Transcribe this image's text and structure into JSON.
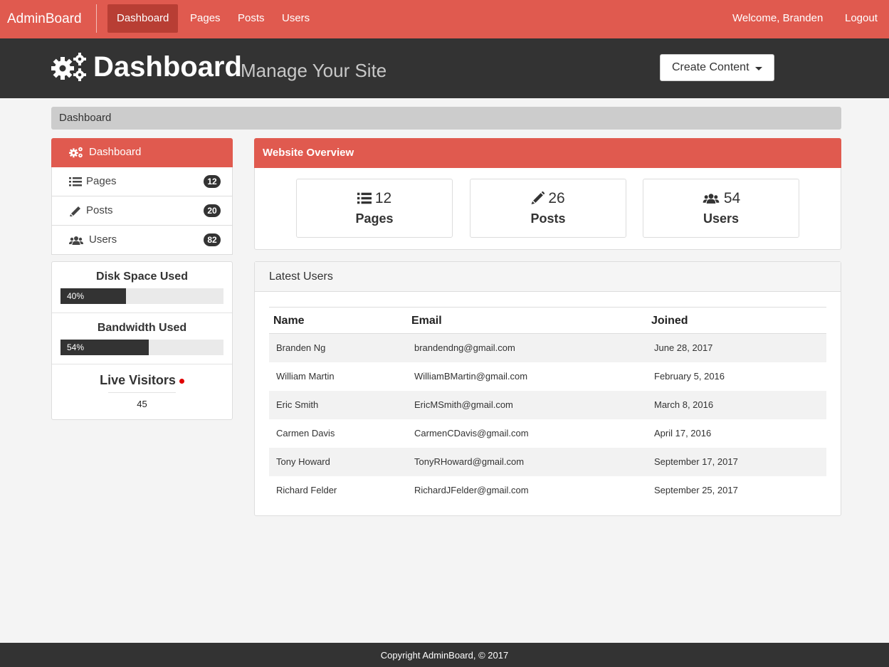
{
  "navbar": {
    "brand": "AdminBoard",
    "links": [
      "Dashboard",
      "Pages",
      "Posts",
      "Users"
    ],
    "active": "Dashboard",
    "welcome": "Welcome, Branden",
    "logout": "Logout",
    "color": "#e05a4f"
  },
  "header": {
    "title": "Dashboard",
    "subtitle": "Manage Your Site",
    "icon": "gears-icon",
    "create_button": "Create Content"
  },
  "breadcrumb": "Dashboard",
  "sidebar": {
    "items": [
      {
        "label": "Dashboard",
        "icon": "gears-icon",
        "active": true
      },
      {
        "label": "Pages",
        "icon": "list-icon",
        "count": "12"
      },
      {
        "label": "Posts",
        "icon": "pencil-icon",
        "count": "20"
      },
      {
        "label": "Users",
        "icon": "users-icon",
        "count": "82"
      }
    ]
  },
  "stats": {
    "disk": {
      "title": "Disk Space Used",
      "label": "40%",
      "percent": 40
    },
    "bandwidth": {
      "title": "Bandwidth Used",
      "label": "54%",
      "percent": 54
    },
    "live": {
      "title": "Live Visitors",
      "count": "45"
    }
  },
  "overview": {
    "title": "Website Overview",
    "cards": [
      {
        "value": "12",
        "label": "Pages",
        "icon": "list-icon"
      },
      {
        "value": "26",
        "label": "Posts",
        "icon": "pencil-icon"
      },
      {
        "value": "54",
        "label": "Users",
        "icon": "users-icon"
      }
    ]
  },
  "latest_users": {
    "title": "Latest Users",
    "columns": [
      "Name",
      "Email",
      "Joined"
    ],
    "rows": [
      [
        "Branden Ng",
        "brandendng@gmail.com",
        "June 28, 2017"
      ],
      [
        "William Martin",
        "WilliamBMartin@gmail.com",
        "February 5, 2016"
      ],
      [
        "Eric Smith",
        "EricMSmith@gmail.com",
        "March 8, 2016"
      ],
      [
        "Carmen Davis",
        "CarmenCDavis@gmail.com",
        "April 17, 2016"
      ],
      [
        "Tony Howard",
        "TonyRHoward@gmail.com",
        "September 17, 2017"
      ],
      [
        "Richard Felder",
        "RichardJFelder@gmail.com",
        "September 25, 2017"
      ]
    ]
  },
  "footer": "Copyright AdminBoard, © 2017"
}
